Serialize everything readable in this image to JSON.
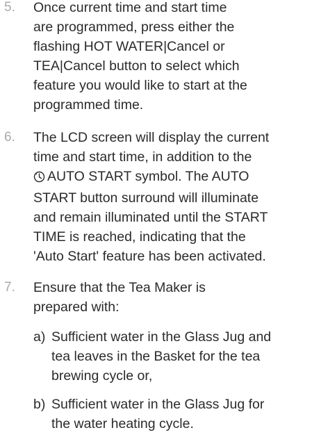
{
  "steps": [
    {
      "number": "5.",
      "lines": [
        "Once current time and start time",
        "are programmed, press either the",
        "flashing HOT WATER|Cancel or",
        "TEA|Cancel button to select which",
        "feature you would like to start at the",
        "programmed time."
      ]
    },
    {
      "number": "6.",
      "lines": [
        "The LCD screen will display the current",
        "time and start time, in addition to the",
        "AUTO START symbol. The AUTO",
        "START button surround will illuminate",
        "and remain illuminated until the START",
        "TIME is reached, indicating that the",
        "'Auto Start' feature has been activated."
      ]
    },
    {
      "number": "7.",
      "lines": [
        "Ensure that the Tea Maker is",
        "prepared with:"
      ],
      "subitems": [
        {
          "label": "a)",
          "lines": [
            "Sufficient water in the Glass Jug and",
            "tea leaves in the Basket for the tea",
            "brewing cycle or,"
          ]
        },
        {
          "label": "b)",
          "lines": [
            "Sufficient water in the Glass Jug for",
            "the water heating cycle."
          ]
        }
      ]
    }
  ],
  "icons": {
    "auto_start": "clock-icon"
  },
  "colors": {
    "text": "#2b2b2b",
    "step_number": "#a9a9a9",
    "background": "#ffffff"
  }
}
